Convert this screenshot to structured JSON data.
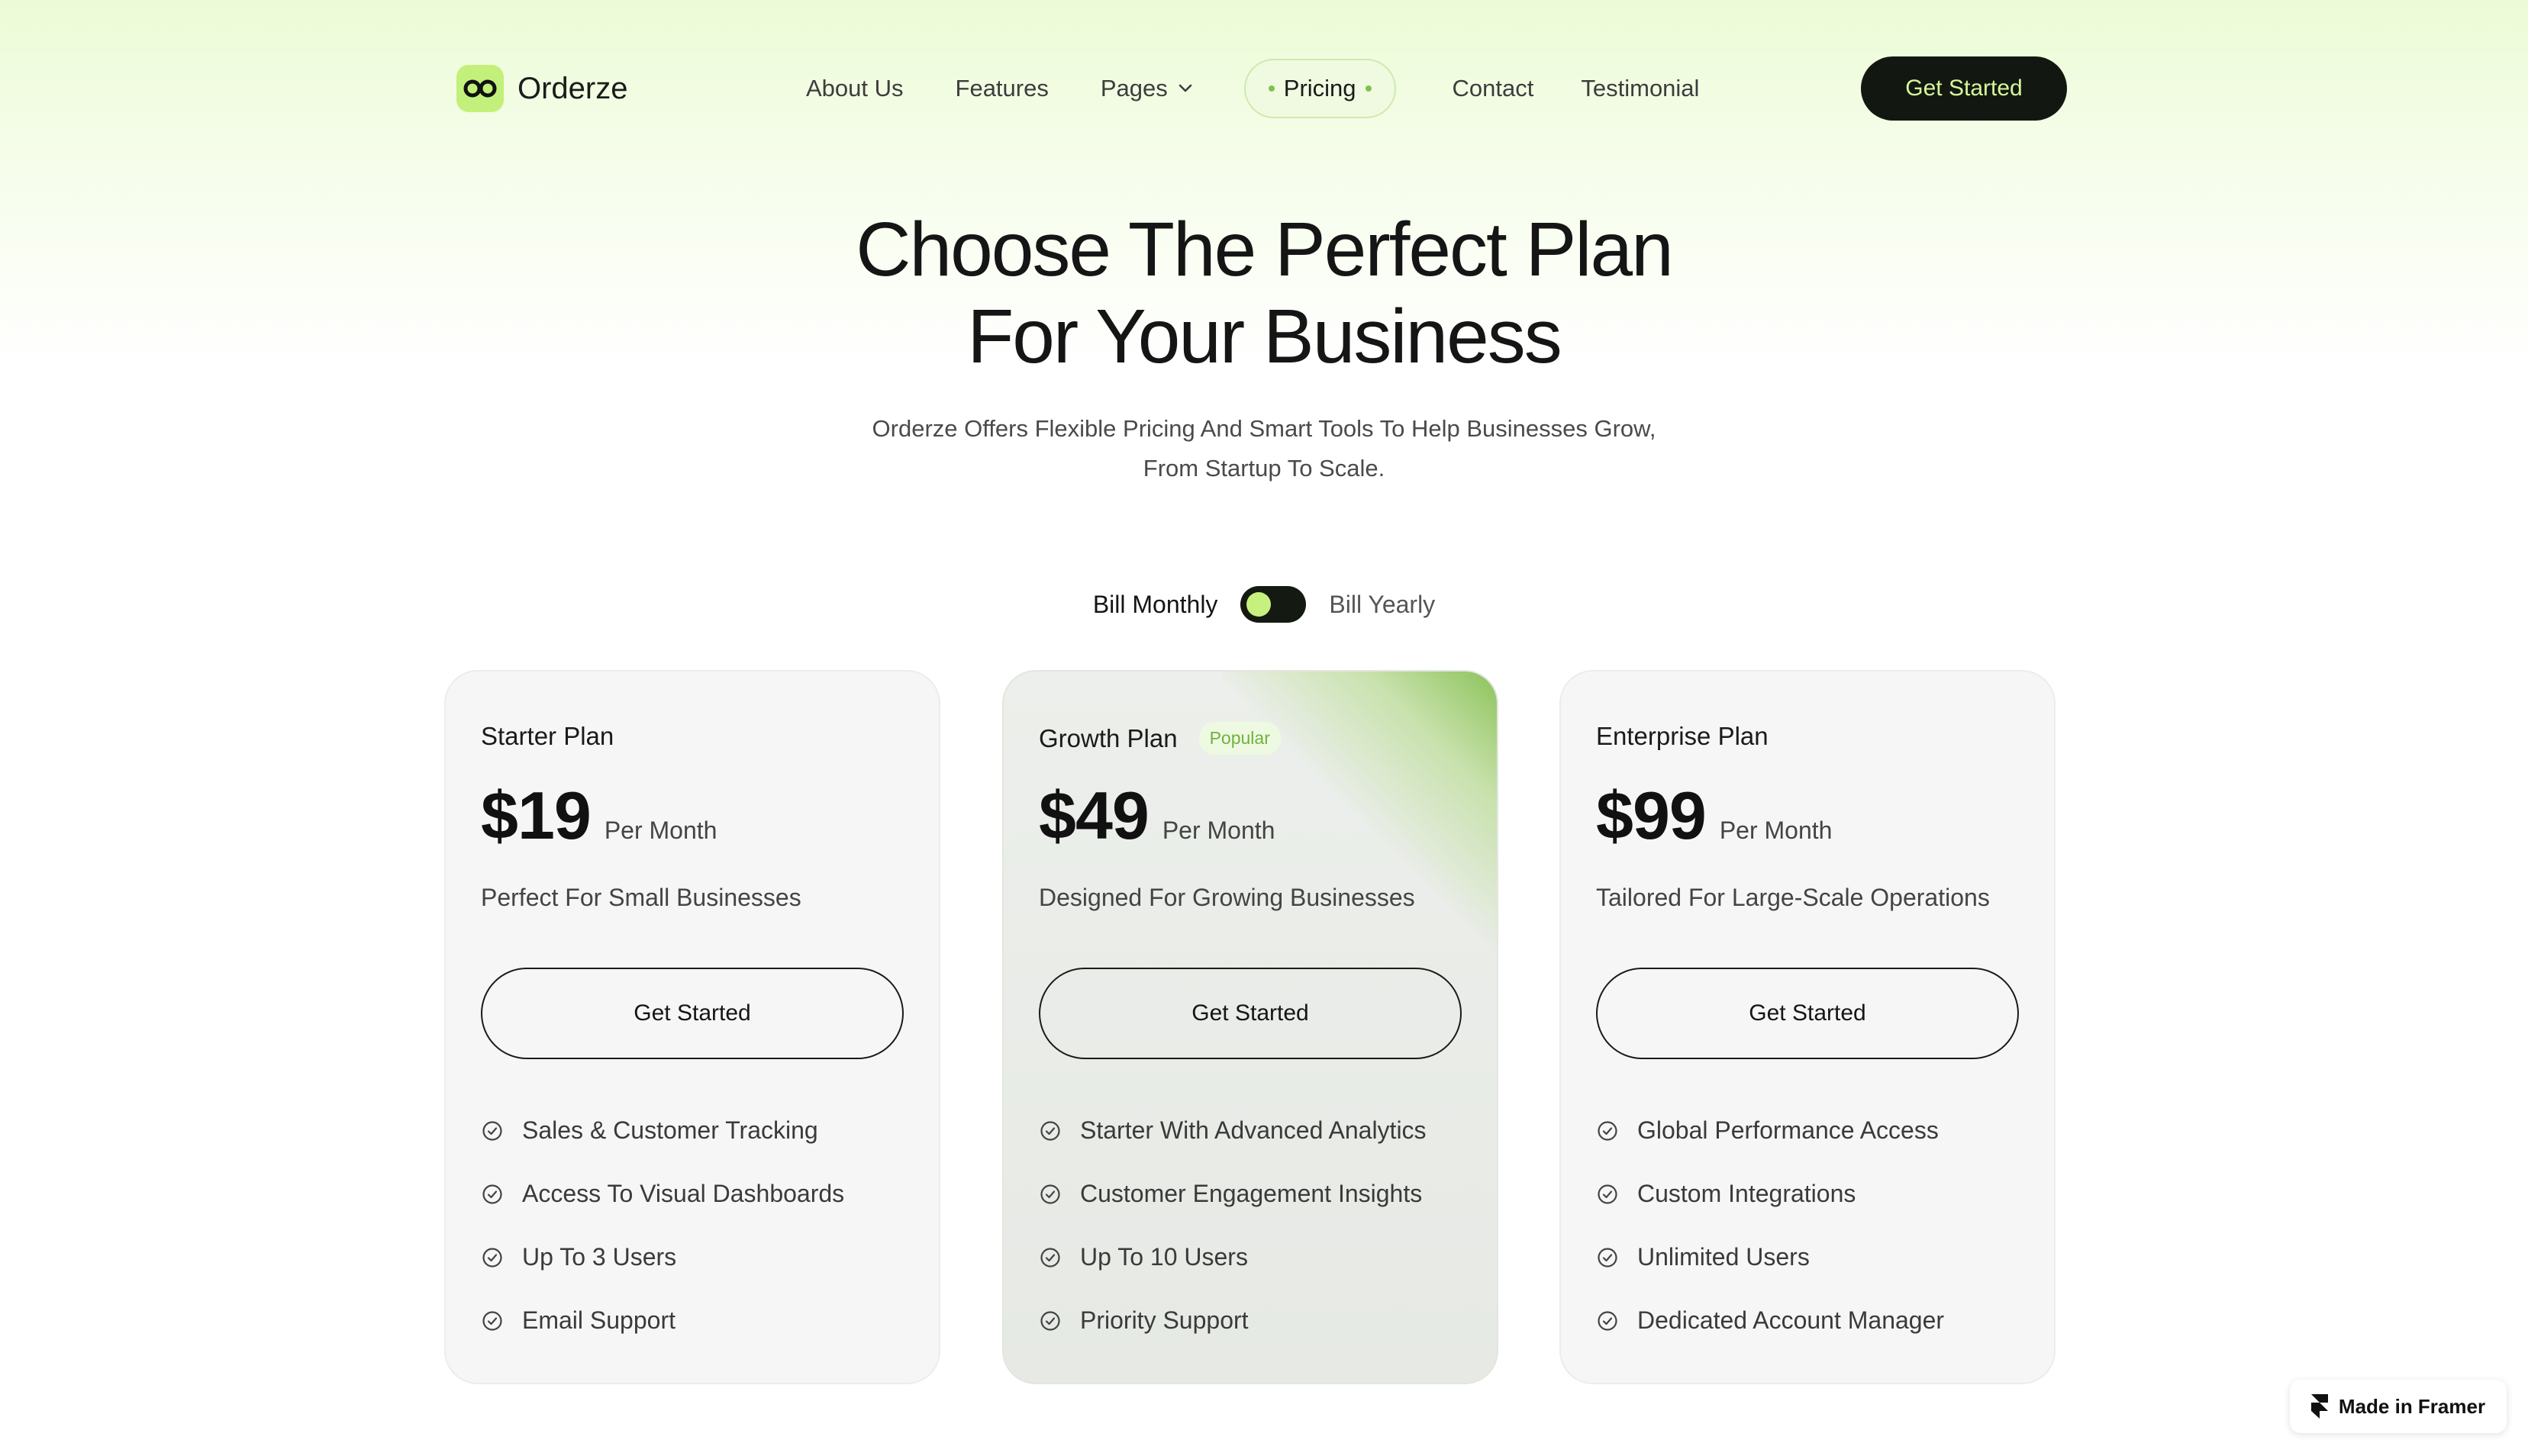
{
  "brand": {
    "name": "Orderze",
    "logo_color": "#c3f07a"
  },
  "nav": {
    "items": [
      "About Us",
      "Features",
      "Pages",
      "Pricing",
      "Contact",
      "Testimonial"
    ],
    "active": "Pricing",
    "cta_label": "Get Started"
  },
  "hero": {
    "title_line1": "Choose The Perfect Plan",
    "title_line2": "For Your Business",
    "subtitle_line1": "Orderze Offers Flexible Pricing And Smart Tools To Help Businesses Grow,",
    "subtitle_line2": "From Startup To Scale."
  },
  "billing": {
    "monthly_label": "Bill Monthly",
    "yearly_label": "Bill Yearly",
    "selected": "Bill Monthly"
  },
  "plans": [
    {
      "name": "Starter Plan",
      "badge": "",
      "price": "$19",
      "period": "Per Month",
      "description": "Perfect For Small Businesses",
      "button": "Get Started",
      "features": [
        "Sales & Customer Tracking",
        "Access To Visual Dashboards",
        "Up To 3 Users",
        "Email Support"
      ]
    },
    {
      "name": "Growth Plan",
      "badge": "Popular",
      "price": "$49",
      "period": "Per Month",
      "description": "Designed For Growing Businesses",
      "button": "Get Started",
      "features": [
        "Starter With Advanced Analytics",
        "Customer Engagement Insights",
        "Up To 10 Users",
        "Priority Support"
      ]
    },
    {
      "name": "Enterprise Plan",
      "badge": "",
      "price": "$99",
      "period": "Per Month",
      "description": "Tailored For Large-Scale Operations",
      "button": "Get Started",
      "features": [
        "Global Performance Access",
        "Custom Integrations",
        "Unlimited Users",
        "Dedicated Account Manager"
      ]
    }
  ],
  "footer_badge": {
    "label": "Made in Framer"
  },
  "colors": {
    "accent": "#c6f17f",
    "dark": "#121811",
    "popular_glow": "#6fb33d"
  }
}
